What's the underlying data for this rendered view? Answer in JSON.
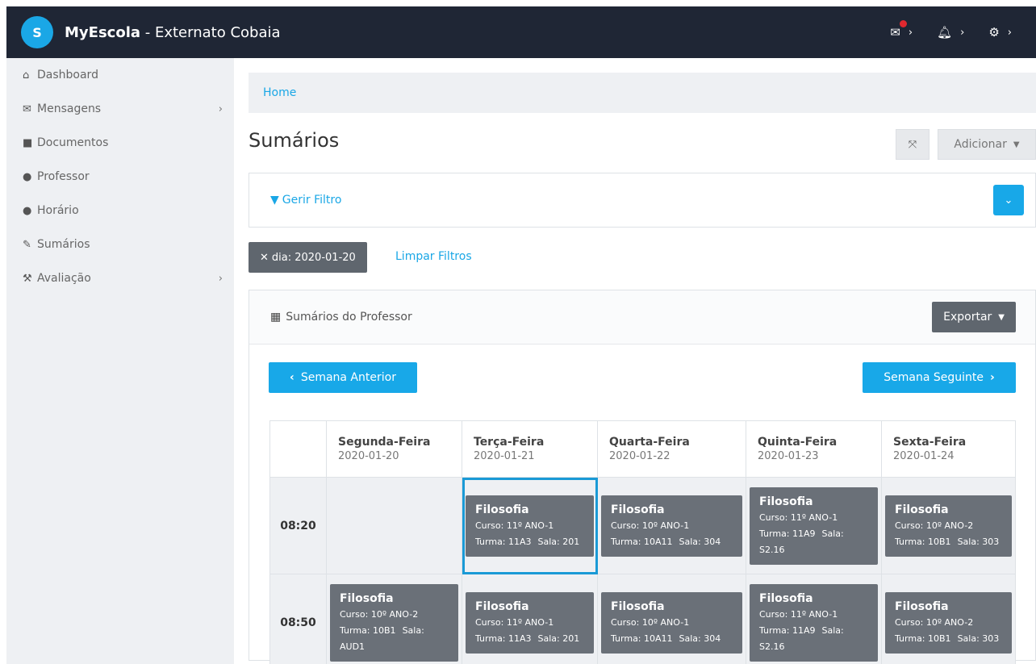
{
  "header": {
    "brand": "MyEscola",
    "separator": " - ",
    "school": "Externato Cobaia",
    "logo_text": "S",
    "icons": [
      "envelope-icon",
      "bell-icon",
      "gear-icon"
    ],
    "accent": "#1aa7e6",
    "notification_color": "#e0282f"
  },
  "sidebar": {
    "items": [
      {
        "label": "Dashboard",
        "icon": "home-icon",
        "has_submenu": false
      },
      {
        "label": "Mensagens",
        "icon": "envelope-icon",
        "has_submenu": true
      },
      {
        "label": "Documentos",
        "icon": "folder-icon",
        "has_submenu": false
      },
      {
        "label": "Professor",
        "icon": "user-icon",
        "has_submenu": false
      },
      {
        "label": "Horário",
        "icon": "users-icon",
        "has_submenu": false
      },
      {
        "label": "Sumários",
        "icon": "edit-icon",
        "has_submenu": false
      },
      {
        "label": "Avaliação",
        "icon": "gavel-icon",
        "has_submenu": true
      }
    ]
  },
  "breadcrumb": {
    "home": "Home"
  },
  "page": {
    "title": "Sumários",
    "add_label": "Adicionar"
  },
  "filter": {
    "manage_label": "Gerir Filtro",
    "active_tag": "dia: 2020-01-20",
    "clear_label": "Limpar Filtros"
  },
  "panel": {
    "title": "Sumários do Professor",
    "export_label": "Exportar",
    "prev_week": "Semana Anterior",
    "next_week": "Semana Seguinte"
  },
  "schedule": {
    "days": [
      {
        "name": "Segunda-Feira",
        "date": "2020-01-20"
      },
      {
        "name": "Terça-Feira",
        "date": "2020-01-21"
      },
      {
        "name": "Quarta-Feira",
        "date": "2020-01-22"
      },
      {
        "name": "Quinta-Feira",
        "date": "2020-01-23"
      },
      {
        "name": "Sexta-Feira",
        "date": "2020-01-24"
      }
    ],
    "rows": [
      {
        "time": "08:20",
        "cells": [
          null,
          {
            "subject": "Filosofia",
            "curso": "Curso: 11º ANO-1",
            "turma": "Turma: 11A3",
            "sala": "Sala: 201",
            "selected": true
          },
          {
            "subject": "Filosofia",
            "curso": "Curso: 10º ANO-1",
            "turma": "Turma: 10A11",
            "sala": "Sala: 304"
          },
          {
            "subject": "Filosofia",
            "curso": "Curso: 11º ANO-1",
            "turma": "Turma: 11A9",
            "sala": "Sala: S2.16"
          },
          {
            "subject": "Filosofia",
            "curso": "Curso: 10º ANO-2",
            "turma": "Turma: 10B1",
            "sala": "Sala: 303"
          }
        ]
      },
      {
        "time": "08:50",
        "cells": [
          {
            "subject": "Filosofia",
            "curso": "Curso: 10º ANO-2",
            "turma": "Turma: 10B1",
            "sala": "Sala: AUD1"
          },
          {
            "subject": "Filosofia",
            "curso": "Curso: 11º ANO-1",
            "turma": "Turma: 11A3",
            "sala": "Sala: 201"
          },
          {
            "subject": "Filosofia",
            "curso": "Curso: 10º ANO-1",
            "turma": "Turma: 10A11",
            "sala": "Sala: 304"
          },
          {
            "subject": "Filosofia",
            "curso": "Curso: 11º ANO-1",
            "turma": "Turma: 11A9",
            "sala": "Sala: S2.16"
          },
          {
            "subject": "Filosofia",
            "curso": "Curso: 10º ANO-2",
            "turma": "Turma: 10B1",
            "sala": "Sala: 303"
          }
        ]
      }
    ]
  }
}
